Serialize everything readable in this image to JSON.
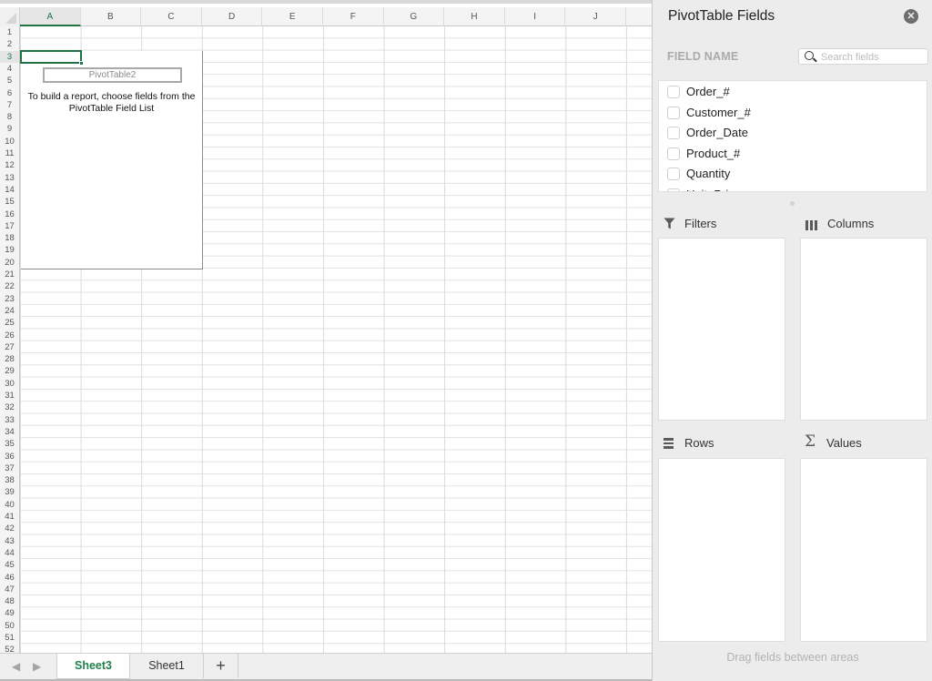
{
  "spreadsheet": {
    "columns": [
      "A",
      "B",
      "C",
      "D",
      "E",
      "F",
      "G",
      "H",
      "I",
      "J",
      ""
    ],
    "active_column": "A",
    "rows": [
      "1",
      "2",
      "3",
      "4",
      "5",
      "6",
      "7",
      "8",
      "9",
      "10",
      "11",
      "12",
      "13",
      "14",
      "15",
      "16",
      "17",
      "18",
      "19",
      "20",
      "21",
      "22",
      "23",
      "24",
      "25",
      "26",
      "27",
      "28",
      "29",
      "30",
      "31",
      "32",
      "33",
      "34",
      "35",
      "36",
      "37",
      "38",
      "39",
      "40",
      "41",
      "42",
      "43",
      "44",
      "45",
      "46",
      "47",
      "48",
      "49",
      "50",
      "51",
      "52"
    ],
    "active_row": "3",
    "selected_cell": "A3",
    "pivot_placeholder": {
      "name": "PivotTable2",
      "message_line1": "To build a report, choose fields from the",
      "message_line2": "PivotTable Field List"
    }
  },
  "sheet_tabs": {
    "prev_icon": "chevron-left-icon",
    "next_icon": "chevron-right-icon",
    "prev_glyph": "◀",
    "next_glyph": "▶",
    "tabs": [
      {
        "label": "Sheet3",
        "active": true
      },
      {
        "label": "Sheet1",
        "active": false
      }
    ],
    "add_glyph": "+"
  },
  "pivot_panel": {
    "title": "PivotTable Fields",
    "close_glyph": "✕",
    "field_name_label": "FIELD NAME",
    "search_placeholder": "Search fields",
    "search_value": "",
    "fields": [
      {
        "label": "Order_#",
        "checked": false
      },
      {
        "label": "Customer_#",
        "checked": false
      },
      {
        "label": "Order_Date",
        "checked": false
      },
      {
        "label": "Product_#",
        "checked": false
      },
      {
        "label": "Quantity",
        "checked": false
      },
      {
        "label": "Unit_Price",
        "checked": false
      }
    ],
    "areas": {
      "filters": "Filters",
      "columns": "Columns",
      "rows": "Rows",
      "values": "Values"
    },
    "sigma_glyph": "Σ",
    "drag_hint": "Drag fields between areas"
  },
  "colors": {
    "accent": "#217346",
    "panel_bg": "#ececec"
  }
}
